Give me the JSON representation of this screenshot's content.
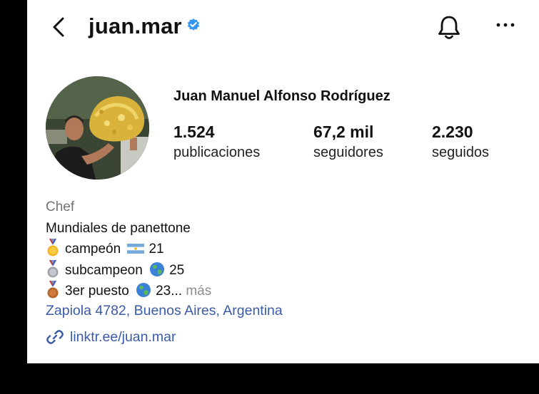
{
  "header": {
    "username": "juan.mar"
  },
  "profile": {
    "full_name": "Juan Manuel Alfonso Rodríguez",
    "stats": [
      {
        "value": "1.524",
        "label": "publicaciones"
      },
      {
        "value": "67,2 mil",
        "label": "seguidores"
      },
      {
        "value": "2.230",
        "label": "seguidos"
      }
    ],
    "category": "Chef",
    "bio_lines": [
      {
        "text": "Mundiales de panettone"
      },
      {
        "medal": "gold-medal-icon",
        "text1": "campeón",
        "badge": "argentina-flag-icon",
        "text2": "21"
      },
      {
        "medal": "silver-medal-icon",
        "text1": "subcampeon",
        "badge": "globe-icon",
        "text2": "25"
      },
      {
        "medal": "bronze-medal-icon",
        "text1": "3er puesto",
        "badge": "globe-icon",
        "text2": "23...",
        "more": "más"
      }
    ],
    "address": "Zapiola 4782, Buenos Aires, Argentina",
    "link": "linktr.ee/juan.mar"
  },
  "colors": {
    "verified": "#3797f0",
    "link": "#3a5ba8",
    "muted": "#737373"
  }
}
